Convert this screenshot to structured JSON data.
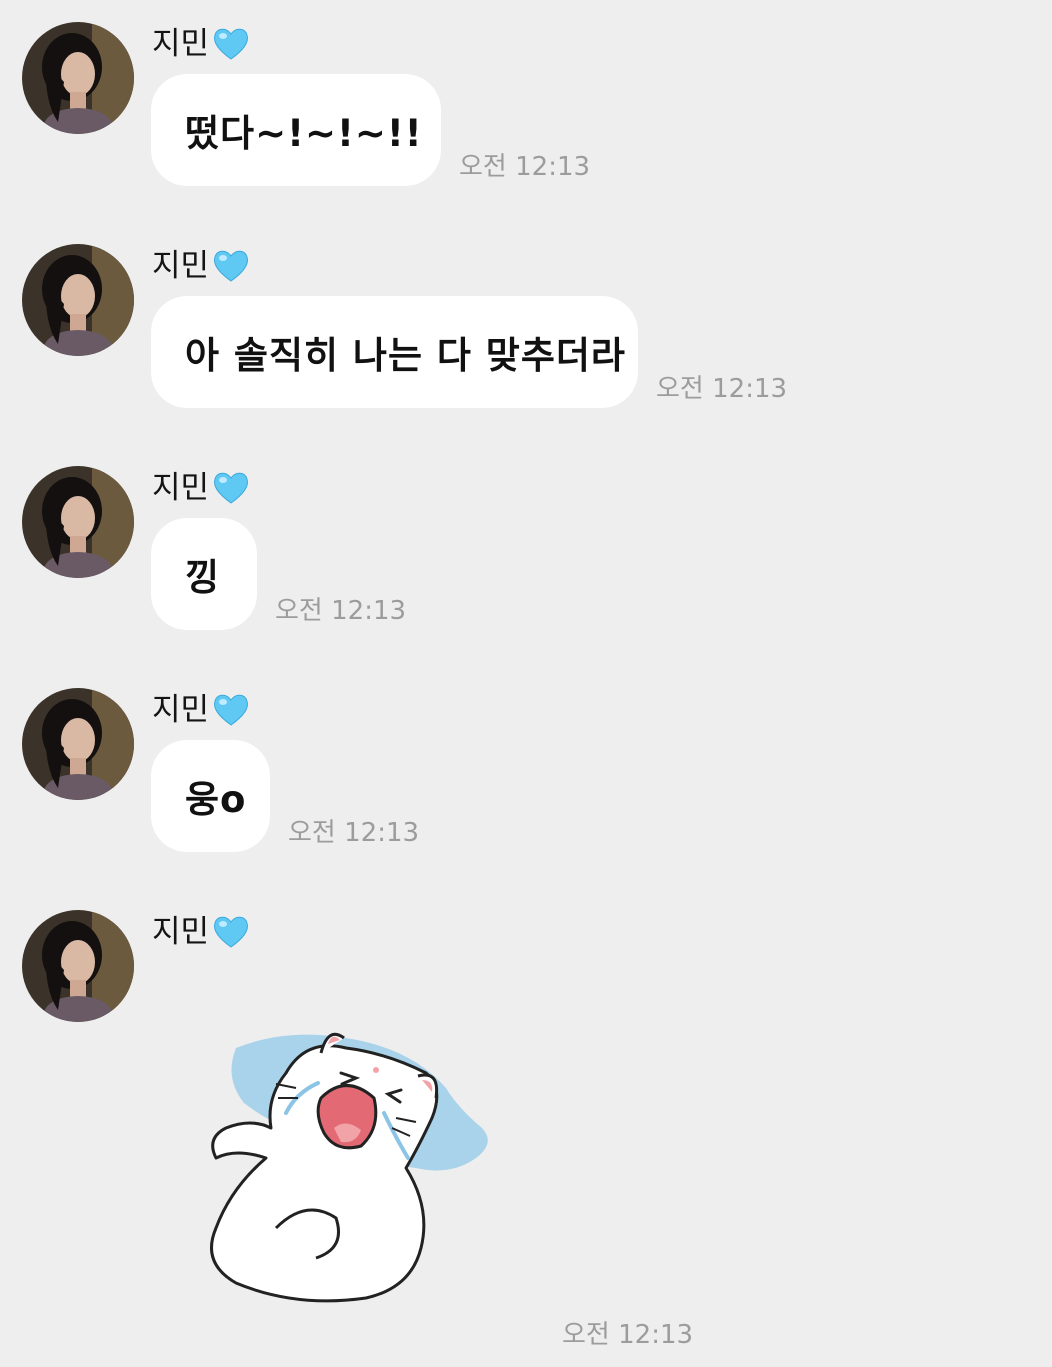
{
  "sender_name": "지민",
  "sender_heart_icon": "blue-heart-icon",
  "messages": [
    {
      "text": "떴다~!~!~!!",
      "time": "오전 12:13"
    },
    {
      "text": "아 솔직히 나는 다 맞추더라",
      "time": "오전 12:13"
    },
    {
      "text": "낑",
      "time": "오전 12:13"
    },
    {
      "text": "웅o",
      "time": "오전 12:13"
    },
    {
      "sticker": "crying-cat-sticker",
      "time": "오전 12:13"
    }
  ],
  "colors": {
    "background": "#eeeeee",
    "bubble": "#ffffff",
    "timestamp": "#9c9c9c",
    "heart": "#5fc9f3"
  }
}
